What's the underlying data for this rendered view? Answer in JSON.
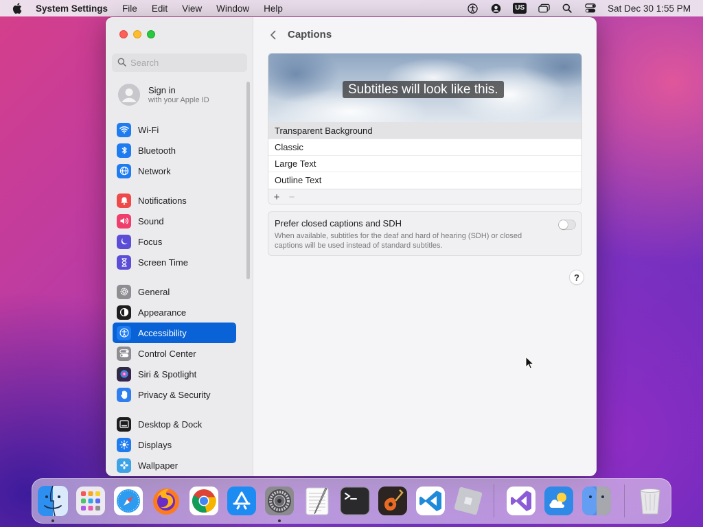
{
  "menubar": {
    "app_name": "System Settings",
    "menus": [
      "File",
      "Edit",
      "View",
      "Window",
      "Help"
    ],
    "keyboard_layout": "US",
    "clock": "Sat Dec 30  1:55 PM"
  },
  "sidebar": {
    "search_placeholder": "Search",
    "account": {
      "name": "Sign in",
      "subtitle": "with your Apple ID"
    },
    "items": [
      {
        "label": "Wi-Fi",
        "icon": "wifi-icon",
        "color": "#1e7cf0"
      },
      {
        "label": "Bluetooth",
        "icon": "bluetooth-icon",
        "color": "#1e7cf0"
      },
      {
        "label": "Network",
        "icon": "globe-icon",
        "color": "#1e7cf0"
      },
      {
        "label": "Notifications",
        "icon": "bell-icon",
        "color": "#ef4a4a"
      },
      {
        "label": "Sound",
        "icon": "speaker-icon",
        "color": "#ef3e6c"
      },
      {
        "label": "Focus",
        "icon": "moon-icon",
        "color": "#5b4dd6"
      },
      {
        "label": "Screen Time",
        "icon": "hourglass-icon",
        "color": "#5b4dd6"
      },
      {
        "label": "General",
        "icon": "gear-icon",
        "color": "#8e8d92"
      },
      {
        "label": "Appearance",
        "icon": "appearance-icon",
        "color": "#1d1d1f"
      },
      {
        "label": "Accessibility",
        "icon": "accessibility-icon",
        "color": "#1e7cf0",
        "active": true
      },
      {
        "label": "Control Center",
        "icon": "toggles-icon",
        "color": "#8e8d92"
      },
      {
        "label": "Siri & Spotlight",
        "icon": "siri-icon",
        "color": "#c13bc6"
      },
      {
        "label": "Privacy & Security",
        "icon": "hand-icon",
        "color": "#2f7ef0"
      },
      {
        "label": "Desktop & Dock",
        "icon": "dock-icon",
        "color": "#1d1d1f"
      },
      {
        "label": "Displays",
        "icon": "sun-icon",
        "color": "#1e7cf0"
      },
      {
        "label": "Wallpaper",
        "icon": "flower-icon",
        "color": "#3da3e6"
      }
    ]
  },
  "content": {
    "title": "Captions",
    "preview_text": "Subtitles will look like this.",
    "styles": [
      "Transparent Background",
      "Classic",
      "Large Text",
      "Outline Text"
    ],
    "add_label": "+",
    "remove_label": "−",
    "sdh": {
      "title": "Prefer closed captions and SDH",
      "description": "When available, subtitles for the deaf and hard of hearing (SDH) or closed captions will be used instead of standard subtitles.",
      "enabled": false
    },
    "help_label": "?"
  },
  "dock": {
    "apps": [
      "Finder",
      "Launchpad",
      "Safari",
      "Firefox",
      "Chrome",
      "App Store",
      "System Settings",
      "TextEdit",
      "Terminal",
      "GarageBand",
      "Visual Studio Code",
      "Roblox",
      "Visual Studio",
      "Weather",
      "Finder Alt",
      "Trash"
    ]
  }
}
